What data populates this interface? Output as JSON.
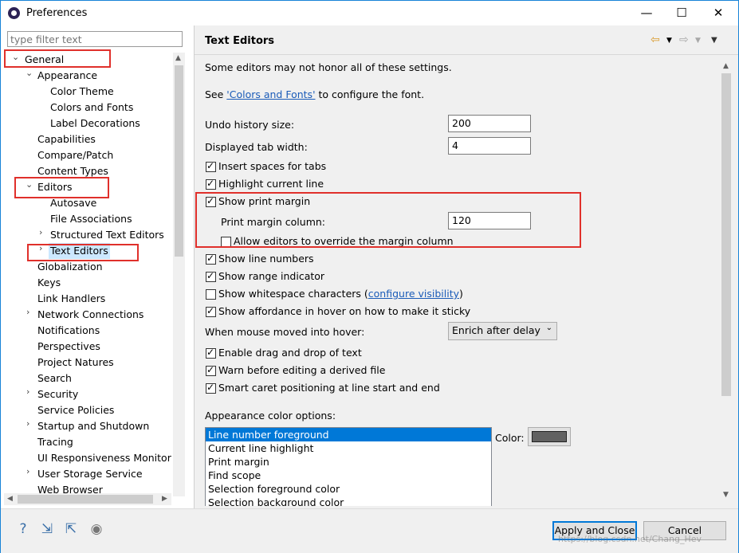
{
  "window": {
    "title": "Preferences",
    "minimize": "—",
    "maximize": "☐",
    "close": "✕"
  },
  "filter": {
    "placeholder": "type filter text"
  },
  "tree": [
    {
      "label": "General",
      "twisty": "⌄"
    },
    {
      "label": "Appearance",
      "twisty": "⌄"
    },
    {
      "label": "Color Theme"
    },
    {
      "label": "Colors and Fonts"
    },
    {
      "label": "Label Decorations"
    },
    {
      "label": "Capabilities"
    },
    {
      "label": "Compare/Patch"
    },
    {
      "label": "Content Types"
    },
    {
      "label": "Editors",
      "twisty": "⌄"
    },
    {
      "label": "Autosave"
    },
    {
      "label": "File Associations"
    },
    {
      "label": "Structured Text Editors",
      "twisty": "›"
    },
    {
      "label": "Text Editors",
      "twisty": "›"
    },
    {
      "label": "Globalization"
    },
    {
      "label": "Keys"
    },
    {
      "label": "Link Handlers"
    },
    {
      "label": "Network Connections",
      "twisty": "›"
    },
    {
      "label": "Notifications"
    },
    {
      "label": "Perspectives"
    },
    {
      "label": "Project Natures"
    },
    {
      "label": "Search"
    },
    {
      "label": "Security",
      "twisty": "›"
    },
    {
      "label": "Service Policies"
    },
    {
      "label": "Startup and Shutdown",
      "twisty": "›"
    },
    {
      "label": "Tracing"
    },
    {
      "label": "UI Responsiveness Monitorin"
    },
    {
      "label": "User Storage Service",
      "twisty": "›"
    },
    {
      "label": "Web Browser"
    }
  ],
  "page": {
    "title": "Text Editors",
    "intro": "Some editors may not honor all of these settings.",
    "see_prefix": "See ",
    "see_link": "'Colors and Fonts'",
    "see_suffix": " to configure the font.",
    "undo_label": "Undo history size:",
    "undo_value": "200",
    "tab_label": "Displayed tab width:",
    "tab_value": "4",
    "insert_spaces": "Insert spaces for tabs",
    "highlight_line": "Highlight current line",
    "show_print_margin": "Show print margin",
    "print_margin_column_label": "Print margin column:",
    "print_margin_column_value": "120",
    "allow_override": "Allow editors to override the margin column",
    "show_line_numbers": "Show line numbers",
    "show_range": "Show range indicator",
    "show_whitespace": "Show whitespace characters (",
    "configure_visibility": "configure visibility",
    "close_paren": ")",
    "show_affordance": "Show affordance in hover on how to make it sticky",
    "hover_label": "When mouse moved into hover:",
    "hover_value": "Enrich after delay",
    "drag_drop": "Enable drag and drop of text",
    "warn_derived": "Warn before editing a derived file",
    "smart_caret": "Smart caret positioning at line start and end",
    "appearance_colors_label": "Appearance color options:",
    "color_options": [
      "Line number foreground",
      "Current line highlight",
      "Print margin",
      "Find scope",
      "Selection foreground color",
      "Selection background color"
    ],
    "color_label": "Color:",
    "color_swatch": "#616161"
  },
  "buttons": {
    "apply_close": "Apply and Close",
    "cancel": "Cancel"
  },
  "watermark": "https://blog.csdn.net/Chang_Hev"
}
